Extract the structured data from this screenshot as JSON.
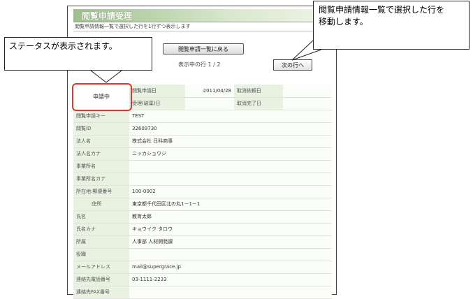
{
  "page": {
    "title": "閲覧申請受理",
    "description": "閲覧申請情報一覧で選択した行を1行ずつ表示します",
    "back_button": "閲覧申請一覧に戻る",
    "row_indicator": "表示中の行 1 / 2",
    "next_button": "次の行へ"
  },
  "status": "申請中",
  "top_rows": [
    {
      "label": "閲覧申請日",
      "value": "2011/04/28",
      "label2": "取消依頼日",
      "value2": ""
    },
    {
      "label": "受理(破棄)日",
      "value": "",
      "label2": "取消完了日",
      "value2": ""
    }
  ],
  "detail_rows": [
    {
      "label": "閲覧申請キー",
      "value": "TEST"
    },
    {
      "label": "閲覧ID",
      "value": "32609730"
    },
    {
      "label": "法人名",
      "value": "株式会社 日科商事"
    },
    {
      "label": "法人名カナ",
      "value": "ニッカショウジ"
    },
    {
      "label": "事業所名",
      "value": ""
    },
    {
      "label": "事業所名カナ",
      "value": ""
    },
    {
      "label": "所在地:郵便番号",
      "value": "100-0002"
    },
    {
      "label": ":住所",
      "value": "東京都千代田区北の丸1－1－1"
    },
    {
      "label": "氏名",
      "value": "教育太郎"
    },
    {
      "label": "氏名カナ",
      "value": "キョウイク タロウ"
    },
    {
      "label": "所属",
      "value": "人事部 人材開発課"
    },
    {
      "label": "役職",
      "value": ""
    },
    {
      "label": "メールアドレス",
      "value": "mail@supergrace.jp"
    },
    {
      "label": "連絡先電話番号",
      "value": "03-1111-2233"
    },
    {
      "label": "連絡先FAX番号",
      "value": ""
    }
  ],
  "annotations": {
    "status_note": "ステータスが表示されます。",
    "next_note_line1": "閲覧申請情報一覧で選択した行を",
    "next_note_line2": "移動します。"
  }
}
